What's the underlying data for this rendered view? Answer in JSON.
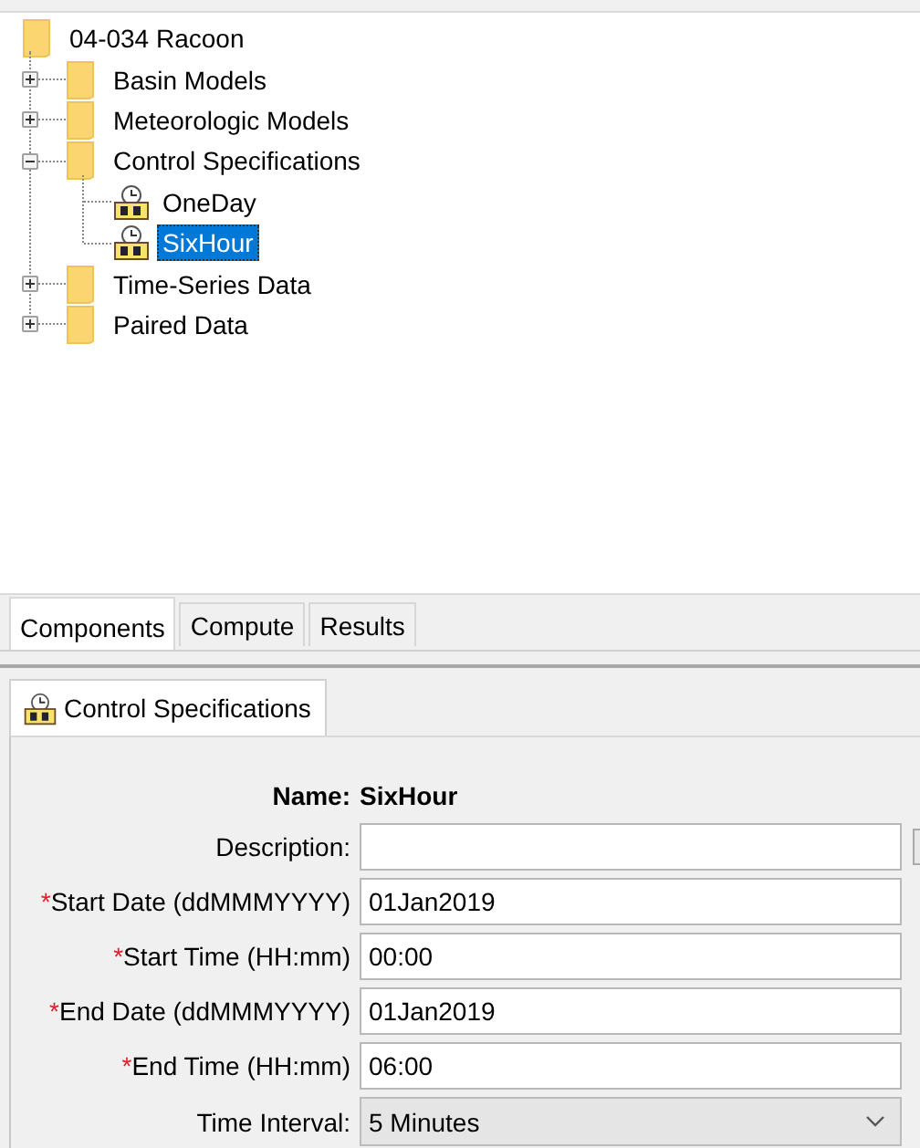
{
  "tree": {
    "root": {
      "label": "04-034 Racoon",
      "kind": "folder",
      "selected": false,
      "children": [
        {
          "label": "Basin Models",
          "kind": "folder",
          "expanded": false,
          "selected": false
        },
        {
          "label": "Meteorologic Models",
          "kind": "folder",
          "expanded": false,
          "selected": false
        },
        {
          "label": "Control Specifications",
          "kind": "folder",
          "expanded": true,
          "selected": false,
          "children": [
            {
              "label": "OneDay",
              "kind": "spec",
              "selected": false
            },
            {
              "label": "SixHour",
              "kind": "spec",
              "selected": true
            }
          ]
        },
        {
          "label": "Time-Series Data",
          "kind": "folder",
          "expanded": false,
          "selected": false
        },
        {
          "label": "Paired Data",
          "kind": "folder",
          "expanded": false,
          "selected": false
        }
      ]
    }
  },
  "tabs": [
    {
      "label": "Components",
      "selected": true
    },
    {
      "label": "Compute",
      "selected": false
    },
    {
      "label": "Results",
      "selected": false
    }
  ],
  "editor": {
    "tab": {
      "label": "Control Specifications",
      "selected": true
    },
    "fields": [
      {
        "kind": "static",
        "label": "Name:",
        "value": "SixHour"
      },
      {
        "kind": "text",
        "label": "Description:",
        "side_button": true
      },
      {
        "kind": "text",
        "required_mark": "*",
        "label": "Start Date (ddMMMYYYY)",
        "value": "01Jan2019"
      },
      {
        "kind": "text",
        "required_mark": "*",
        "label": "Start Time (HH:mm)",
        "value": "00:00"
      },
      {
        "kind": "text",
        "required_mark": "*",
        "label": "End Date (ddMMMYYYY)",
        "value": "01Jan2019"
      },
      {
        "kind": "text",
        "required_mark": "*",
        "label": "End Time (HH:mm)",
        "value": "06:00"
      },
      {
        "kind": "dropdown",
        "label": "Time Interval:",
        "value": "5 Minutes"
      }
    ]
  }
}
